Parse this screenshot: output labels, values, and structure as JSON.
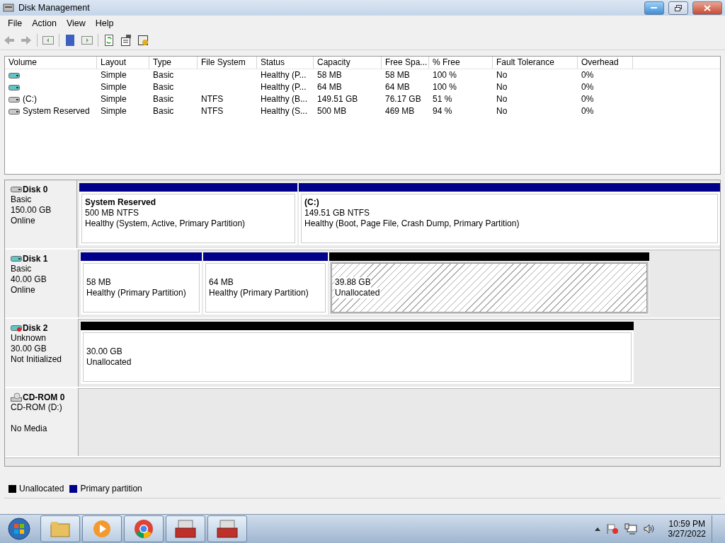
{
  "window": {
    "title": "Disk Management"
  },
  "menu": [
    "File",
    "Action",
    "View",
    "Help"
  ],
  "table": {
    "columns": [
      "Volume",
      "Layout",
      "Type",
      "File System",
      "Status",
      "Capacity",
      "Free Spa...",
      "% Free",
      "Fault Tolerance",
      "Overhead"
    ],
    "rows": [
      {
        "kind": "removable",
        "cells": [
          "",
          "Simple",
          "Basic",
          "",
          "Healthy (P...",
          "58 MB",
          "58 MB",
          "100 %",
          "No",
          "0%"
        ]
      },
      {
        "kind": "removable",
        "cells": [
          "",
          "Simple",
          "Basic",
          "",
          "Healthy (P...",
          "64 MB",
          "64 MB",
          "100 %",
          "No",
          "0%"
        ]
      },
      {
        "kind": "fixed",
        "cells": [
          "(C:)",
          "Simple",
          "Basic",
          "NTFS",
          "Healthy (B...",
          "149.51 GB",
          "76.17 GB",
          "51 %",
          "No",
          "0%"
        ]
      },
      {
        "kind": "fixed",
        "cells": [
          "System Reserved",
          "Simple",
          "Basic",
          "NTFS",
          "Healthy (S...",
          "500 MB",
          "469 MB",
          "94 %",
          "No",
          "0%"
        ]
      }
    ]
  },
  "disks": [
    {
      "kind": "fixed",
      "name": "Disk 0",
      "lines": [
        "Basic",
        "150.00 GB",
        "Online"
      ],
      "partitions": [
        {
          "kind": "primary",
          "selected": false,
          "title": "System Reserved",
          "lines": [
            "500 MB NTFS",
            "Healthy (System, Active, Primary Partition)"
          ]
        },
        {
          "kind": "primary",
          "selected": false,
          "title": "(C:)",
          "lines": [
            "149.51 GB NTFS",
            "Healthy (Boot, Page File, Crash Dump, Primary Partition)"
          ]
        }
      ]
    },
    {
      "kind": "removable",
      "name": "Disk 1",
      "lines": [
        "Basic",
        "40.00 GB",
        "Online"
      ],
      "partitions": [
        {
          "kind": "primary",
          "selected": false,
          "lines": [
            "58 MB",
            "Healthy (Primary Partition)"
          ]
        },
        {
          "kind": "primary",
          "selected": false,
          "lines": [
            "64 MB",
            "Healthy (Primary Partition)"
          ]
        },
        {
          "kind": "unallocated",
          "selected": true,
          "lines": [
            "39.88 GB",
            "Unallocated"
          ]
        }
      ]
    },
    {
      "kind": "uninitialized",
      "name": "Disk 2",
      "lines": [
        "Unknown",
        "30.00 GB",
        "Not Initialized"
      ],
      "partitions": [
        {
          "kind": "unallocated",
          "selected": false,
          "lines": [
            "30.00 GB",
            "Unallocated"
          ]
        }
      ]
    },
    {
      "kind": "cdrom",
      "name": "CD-ROM 0",
      "lines": [
        "CD-ROM (D:)",
        "No Media"
      ]
    }
  ],
  "legend": [
    {
      "label": "Unallocated",
      "color": "#000000"
    },
    {
      "label": "Primary partition",
      "color": "#00008b"
    }
  ],
  "clock": {
    "time": "10:59 PM",
    "date": "3/27/2022"
  }
}
